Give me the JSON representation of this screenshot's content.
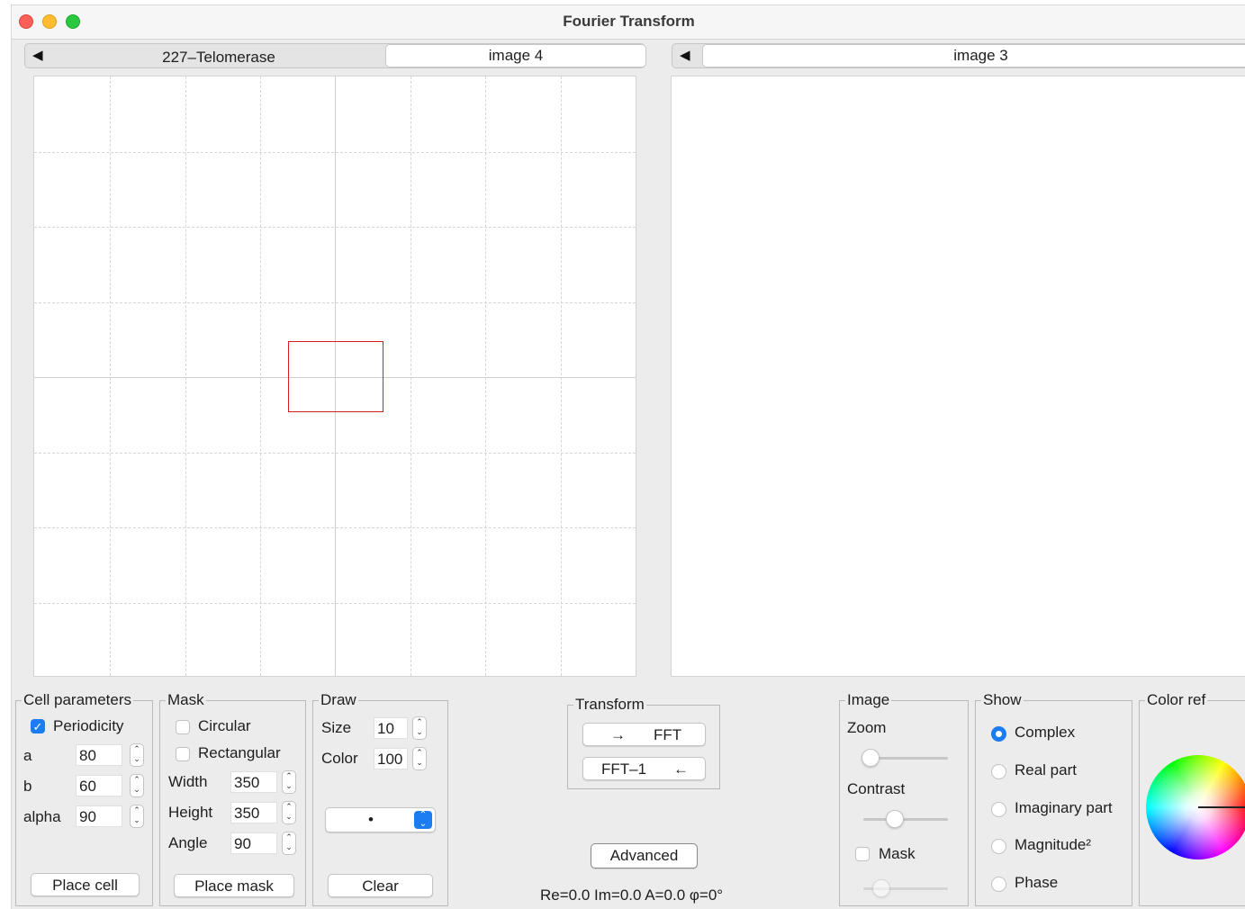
{
  "window": {
    "title": "Fourier Transform"
  },
  "left_tabs": {
    "arrow": "◀",
    "tabs": [
      "227–Telomerase",
      "image 4"
    ],
    "selected": 1
  },
  "right_tabs": {
    "arrow": "◀",
    "tabs": [
      "image 3"
    ],
    "selected": 0
  },
  "cell_parameters": {
    "title": "Cell parameters",
    "periodicity_label": "Periodicity",
    "periodicity_checked": true,
    "a_label": "a",
    "a_value": "80",
    "b_label": "b",
    "b_value": "60",
    "alpha_label": "alpha",
    "alpha_value": "90",
    "place_button": "Place cell"
  },
  "mask": {
    "title": "Mask",
    "circular_label": "Circular",
    "rectangular_label": "Rectangular",
    "width_label": "Width",
    "width_value": "350",
    "height_label": "Height",
    "height_value": "350",
    "angle_label": "Angle",
    "angle_value": "90",
    "place_button": "Place mask"
  },
  "draw": {
    "title": "Draw",
    "size_label": "Size",
    "size_value": "10",
    "color_label": "Color",
    "color_value": "100",
    "brush_value": "•",
    "clear_button": "Clear"
  },
  "transform": {
    "title": "Transform",
    "fft_arrow": "→",
    "fft_label": "FFT",
    "ifft_label": "FFT–1",
    "ifft_arrow": "←"
  },
  "advanced_button": "Advanced",
  "status_text": "Re=0.0 Im=0.0 A=0.0 φ=0°",
  "image_group": {
    "title": "Image",
    "zoom_label": "Zoom",
    "zoom_level": 0.0,
    "contrast_label": "Contrast",
    "contrast_level": 0.35,
    "mask_label": "Mask",
    "mask_level": 0.15
  },
  "show": {
    "title": "Show",
    "options": [
      "Complex",
      "Real part",
      "Imaginary part",
      "Magnitude²",
      "Phase"
    ],
    "selected": "Complex"
  },
  "color_ref": {
    "title": "Color ref"
  },
  "colors": {
    "accent": "#1c7cf2",
    "cell_outline": "#d81e1e",
    "window_bg": "#ececec"
  },
  "icons": {
    "spinner": "up-down-spinner-icon",
    "dropdown": "chevron-updown-icon"
  }
}
